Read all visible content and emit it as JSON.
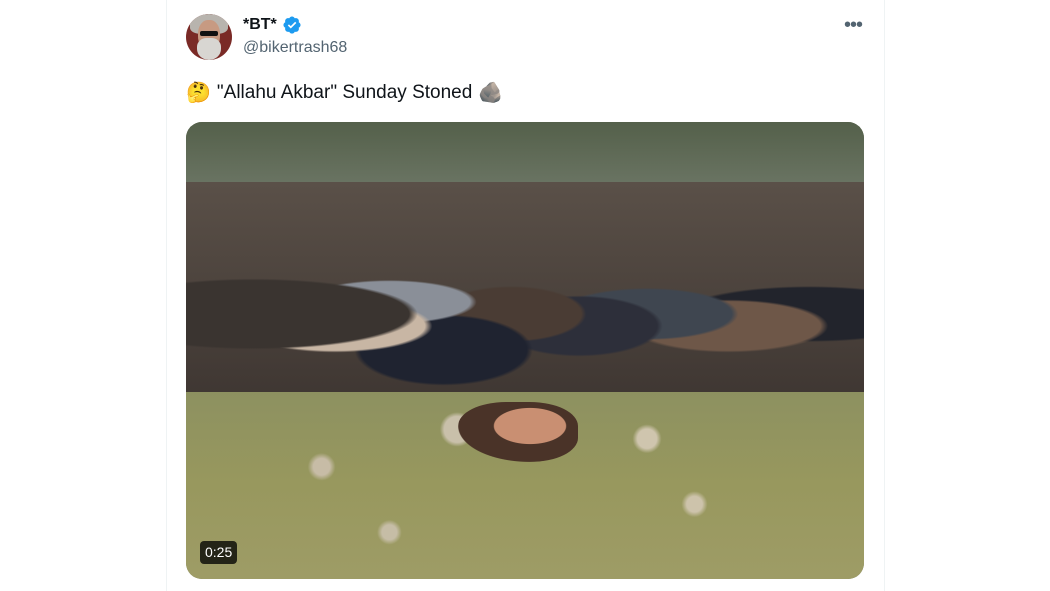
{
  "author": {
    "display_name": "*BT*",
    "handle": "@bikertrash68",
    "verified": true,
    "accent_color": "#1d9bf0"
  },
  "header": {
    "more_glyph": "•••"
  },
  "tweet": {
    "emoji_leading": "🤔",
    "text": "\"Allahu Akbar\" Sunday Stoned",
    "emoji_trailing": "🪨"
  },
  "media": {
    "type": "video",
    "duration": "0:25"
  },
  "icons": {
    "avatar": "avatar",
    "verified": "verified-badge-icon",
    "more": "more-options-icon"
  }
}
